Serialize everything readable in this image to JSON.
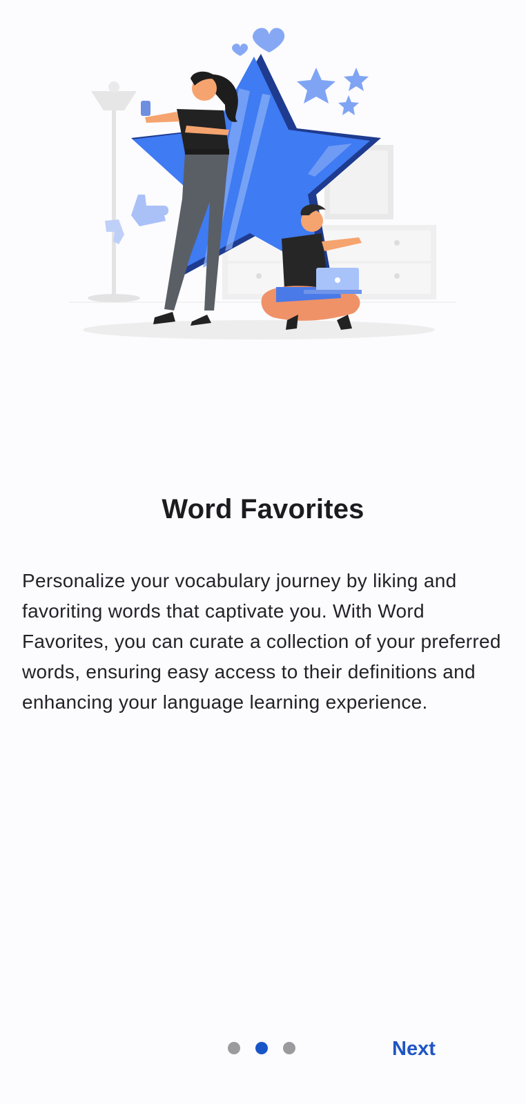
{
  "onboarding": {
    "title": "Word Favorites",
    "description": "Personalize your vocabulary journey by liking and favoriting words that captivate you. With Word Favorites, you can curate a collection of your preferred words, ensuring easy access to their definitions and enhancing your language learning experience.",
    "next_label": "Next",
    "page_count": 3,
    "active_page": 2
  },
  "colors": {
    "accent": "#1E55C4",
    "star": "#3F7BF2",
    "star_dark": "#1E3B8F",
    "dot_inactive": "#9B9B9F",
    "background": "#FCFBFE"
  },
  "illustration": {
    "icon": "star-favorites-illustration"
  }
}
